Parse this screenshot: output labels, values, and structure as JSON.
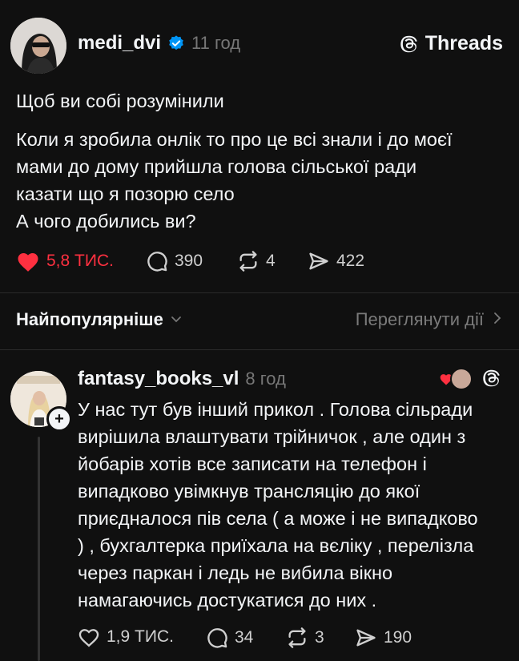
{
  "brand": {
    "name": "Threads",
    "icon": "threads-logo-icon"
  },
  "post": {
    "username": "medi_dvi",
    "verified": true,
    "time": "11 год",
    "lines": [
      "Щоб ви собі розумінили",
      "Коли я зробила онлік то про це всі знали і до моєї",
      "мами до дому прийшла голова сільської ради",
      "казати що я позорю село",
      "А чого добились ви?"
    ],
    "likes": "5,8 ТИС.",
    "liked": true,
    "comments": "390",
    "reposts": "4",
    "shares": "422"
  },
  "sort_bar": {
    "sort_label": "Найпопулярніше",
    "view_label": "Переглянути дії"
  },
  "reply": {
    "username": "fantasy_books_vl",
    "time": "8 год",
    "lines": [
      "У нас тут був інший прикол . Голова сільради",
      "вирішила влаштувати трійничок , але один з",
      "йобарів хотів все записати на телефон і",
      "випадково увімкнув трансляцію до якої",
      "приєдналося пів села ( а може і не випадково",
      ") , бухгалтерка приїхала на вєліку , перелізла",
      "через паркан і ледь не вибила вікно",
      "намагаючись достукатися до них ."
    ],
    "likes": "1,9 ТИС.",
    "comments": "34",
    "reposts": "3",
    "shares": "190"
  },
  "colors": {
    "background": "#101010",
    "text": "#f3f5f7",
    "muted": "#777777",
    "like_red": "#ff3040",
    "verified_blue": "#0095f6"
  }
}
